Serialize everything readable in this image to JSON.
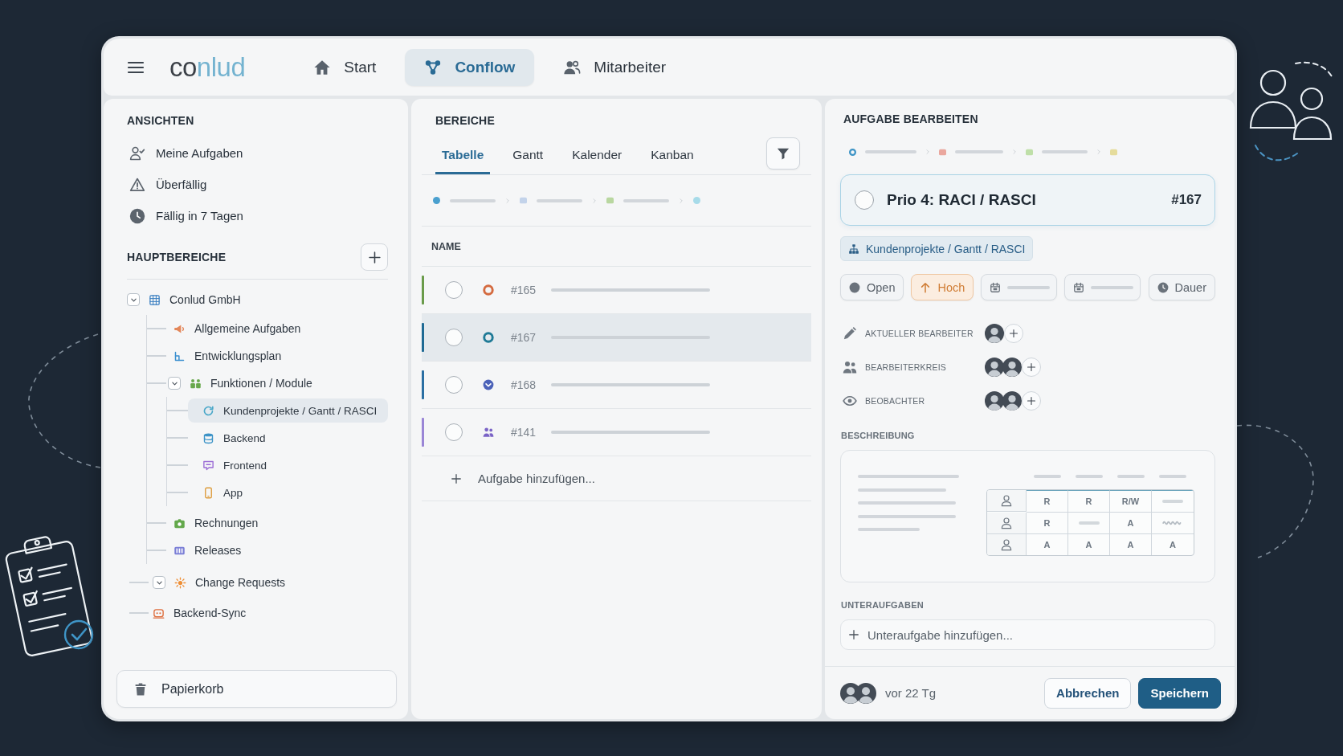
{
  "header": {
    "logo": "conlud",
    "nav": [
      {
        "label": "Start",
        "kind": "home",
        "selected": false
      },
      {
        "label": "Conflow",
        "kind": "flow",
        "selected": true
      },
      {
        "label": "Mitarbeiter",
        "kind": "people",
        "selected": false
      }
    ]
  },
  "sidebar": {
    "views_title": "ANSICHTEN",
    "views": [
      {
        "label": "Meine Aufgaben",
        "kind": "mine"
      },
      {
        "label": "Überfällig",
        "kind": "overdue"
      },
      {
        "label": "Fällig in 7 Tagen",
        "kind": "due"
      }
    ],
    "areas_title": "HAUPTBEREICHE",
    "tree": [
      {
        "label": "Conlud GmbH",
        "kind": "company",
        "selected": false,
        "expanded": true,
        "children": [
          {
            "label": "Allgemeine Aufgaben",
            "kind": "announce",
            "selected": false
          },
          {
            "label": "Entwicklungsplan",
            "kind": "plan",
            "selected": false
          },
          {
            "label": "Funktionen / Module",
            "kind": "modules",
            "selected": false,
            "expanded": true,
            "children": [
              {
                "label": "Kundenprojekte / Gantt / RASCI",
                "kind": "sync",
                "selected": true
              },
              {
                "label": "Backend",
                "kind": "database",
                "selected": false
              },
              {
                "label": "Frontend",
                "kind": "screen",
                "selected": false
              },
              {
                "label": "App",
                "kind": "phone",
                "selected": false
              }
            ]
          },
          {
            "label": "Rechnungen",
            "kind": "camera",
            "selected": false
          },
          {
            "label": "Releases",
            "kind": "barcode",
            "selected": false
          }
        ]
      },
      {
        "label": "Change Requests",
        "kind": "sun",
        "selected": false,
        "expanded": true
      },
      {
        "label": "Backend-Sync",
        "kind": "robot",
        "selected": false
      }
    ],
    "trash": "Papierkorb"
  },
  "list_panel": {
    "title": "BEREICHE",
    "tabs": [
      {
        "label": "Tabelle",
        "selected": true
      },
      {
        "label": "Gantt",
        "selected": false
      },
      {
        "label": "Kalender",
        "selected": false
      },
      {
        "label": "Kanban",
        "selected": false
      }
    ],
    "crumbs": [
      {
        "kind": "dot",
        "color": "#4aa0cf"
      },
      {
        "kind": "tile",
        "color": "#c3d3ea"
      },
      {
        "kind": "tile",
        "color": "#b9d7a0"
      },
      {
        "kind": "dot",
        "color": "#a7dbe9"
      }
    ],
    "column": "NAME",
    "rows": [
      {
        "id": "#165",
        "selected": false,
        "done": false,
        "color": "#6a9b4a",
        "status": {
          "kind": "ring",
          "color": "#d46a3f"
        }
      },
      {
        "id": "#167",
        "selected": true,
        "done": false,
        "color": "#1f6a94",
        "status": {
          "kind": "ring",
          "color": "#1f7a96"
        }
      },
      {
        "id": "#168",
        "selected": false,
        "done": false,
        "color": "#2a6fa3",
        "status": {
          "kind": "check",
          "color": "#4b62b8"
        }
      },
      {
        "id": "#141",
        "selected": false,
        "done": false,
        "color": "#9a86d6",
        "status": {
          "kind": "group",
          "color": "#7a63c6"
        }
      }
    ],
    "add_label": "Aufgabe hinzufügen..."
  },
  "editor": {
    "title": "AUFGABE BEARBEITEN",
    "crumbs": [
      {
        "kind": "ring",
        "color": "#3c93c5"
      },
      {
        "kind": "tile",
        "color": "#eaa79e"
      },
      {
        "kind": "tile",
        "color": "#bfdfa8"
      },
      {
        "kind": "tile",
        "color": "#e5dc9c"
      }
    ],
    "task": {
      "title": "Prio 4: RACI / RASCI",
      "id": "#167",
      "done": false
    },
    "path": "Kundenprojekte / Gantt / RASCI",
    "chips": [
      {
        "kind": "status",
        "label": "Open"
      },
      {
        "kind": "priority",
        "label": "Hoch"
      },
      {
        "kind": "date"
      },
      {
        "kind": "date"
      },
      {
        "kind": "duration",
        "label": "Dauer"
      }
    ],
    "people": [
      {
        "kind": "editor",
        "label": "AKTUELLER BEARBEITER",
        "avatars": [
          {
            "kind": "person"
          }
        ]
      },
      {
        "kind": "team",
        "label": "BEARBEITERKREIS",
        "avatars": [
          {
            "kind": "person"
          },
          {
            "kind": "person"
          }
        ]
      },
      {
        "kind": "watch",
        "label": "BEOBACHTER",
        "avatars": [
          {
            "kind": "person"
          },
          {
            "kind": "person"
          }
        ]
      }
    ],
    "description_title": "BESCHREIBUNG",
    "raci_rows": [
      {
        "cells": [
          {
            "kind": "letter",
            "text": "R"
          },
          {
            "kind": "letter",
            "text": "R"
          },
          {
            "kind": "letter",
            "text": "R/W"
          },
          {
            "kind": "bar"
          }
        ]
      },
      {
        "cells": [
          {
            "kind": "letter",
            "text": "R"
          },
          {
            "kind": "bar"
          },
          {
            "kind": "letter",
            "text": "A"
          },
          {
            "kind": "scribble"
          }
        ]
      },
      {
        "cells": [
          {
            "kind": "letter",
            "text": "A"
          },
          {
            "kind": "letter",
            "text": "A"
          },
          {
            "kind": "letter",
            "text": "A"
          },
          {
            "kind": "letter",
            "text": "A"
          }
        ]
      }
    ],
    "subtasks_title": "UNTERAUFGABEN",
    "subtask_placeholder": "Unteraufgabe hinzufügen...",
    "footer": {
      "avatars": [
        {
          "kind": "person"
        },
        {
          "kind": "person"
        }
      ],
      "time": "vor 22 Tg",
      "cancel": "Abbrechen",
      "save": "Speichern"
    }
  }
}
